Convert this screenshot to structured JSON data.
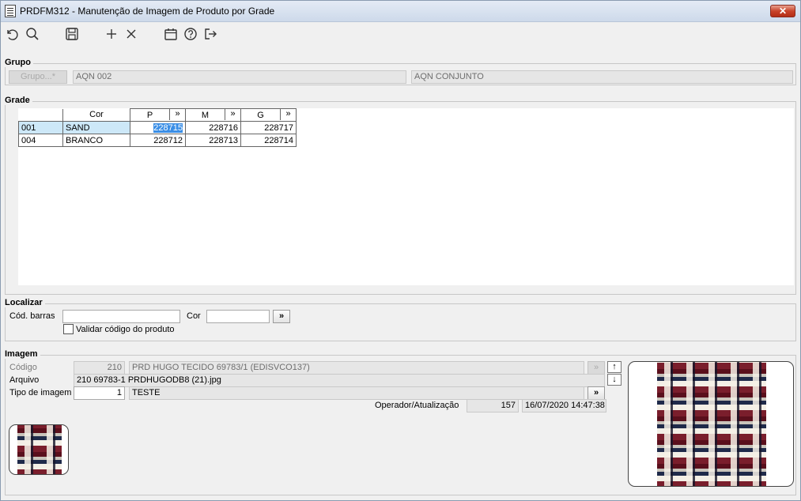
{
  "window": {
    "title": "PRDFM312 - Manutenção de Imagem de Produto por Grade",
    "close": "✕"
  },
  "toolbar": [
    "undo-icon",
    "search-icon",
    "save-icon",
    "add-icon",
    "delete-icon",
    "calendar-icon",
    "help-icon",
    "exit-icon"
  ],
  "grupo": {
    "legend": "Grupo",
    "button": "Grupo...*",
    "code": "AQN 002",
    "description": "AQN CONJUNTO"
  },
  "grade": {
    "legend": "Grade",
    "headers": {
      "cor": "Cor",
      "p": "P",
      "m": "M",
      "g": "G",
      "expand": "»"
    },
    "rows": [
      {
        "code": "001",
        "cor": "SAND",
        "p": "228715",
        "m": "228716",
        "g": "228717"
      },
      {
        "code": "004",
        "cor": "BRANCO",
        "p": "228712",
        "m": "228713",
        "g": "228714"
      }
    ]
  },
  "localizar": {
    "legend": "Localizar",
    "barcode_label": "Cód. barras",
    "barcode_value": "",
    "cor_label": "Cor",
    "cor_value": "",
    "search_button": "»",
    "validate_label": "Validar código do produto"
  },
  "imagem": {
    "legend": "Imagem",
    "codigo_label": "Código",
    "codigo_value": "210",
    "codigo_desc": "PRD HUGO TECIDO 69783/1 (EDISVCO137)",
    "arquivo_label": "Arquivo",
    "arquivo_value": "210 69783-1 PRDHUGODB8 (21).jpg",
    "tipo_label": "Tipo de imagem",
    "tipo_value": "1",
    "tipo_desc": "TESTE",
    "tipo_button": "»",
    "operador_label": "Operador/Atualização",
    "operador_value": "157",
    "atualizacao_value": "16/07/2020 14:47:38",
    "up_button": "↑",
    "down_button": "↓",
    "disabled_button": "»"
  }
}
